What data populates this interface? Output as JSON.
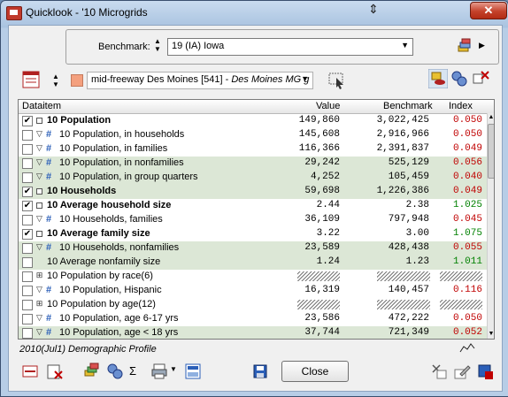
{
  "window": {
    "title": "Quicklook - '10 Microgrids",
    "close_glyph": "✕"
  },
  "benchmark": {
    "label": "Benchmark:",
    "value": "19 (IA) Iowa"
  },
  "geography": {
    "value": "mid-freeway Des Moines [541] - ",
    "value_italic": "Des Moines MG g",
    "swatch_color": "#f4a07e"
  },
  "grid": {
    "headers": {
      "item": "Dataitem",
      "value": "Value",
      "benchmark": "Benchmark",
      "index": "Index"
    },
    "rows": [
      {
        "checked": true,
        "kind": "header",
        "label": "10 Population",
        "bold": true,
        "value": "149,860",
        "benchmark": "3,022,425",
        "index": "0.050",
        "index_color": "#c00000",
        "shade": false
      },
      {
        "checked": false,
        "kind": "item",
        "label": "10 Population, in households",
        "bold": false,
        "value": "145,608",
        "benchmark": "2,916,966",
        "index": "0.050",
        "index_color": "#c00000",
        "shade": false
      },
      {
        "checked": false,
        "kind": "item",
        "label": "10 Population, in families",
        "bold": false,
        "value": "116,366",
        "benchmark": "2,391,837",
        "index": "0.049",
        "index_color": "#c00000",
        "shade": false
      },
      {
        "checked": false,
        "kind": "item",
        "label": "10 Population, in nonfamilies",
        "bold": false,
        "value": "29,242",
        "benchmark": "525,129",
        "index": "0.056",
        "index_color": "#c00000",
        "shade": true
      },
      {
        "checked": false,
        "kind": "item",
        "label": "10 Population, in group quarters",
        "bold": false,
        "value": "4,252",
        "benchmark": "105,459",
        "index": "0.040",
        "index_color": "#c00000",
        "shade": true
      },
      {
        "checked": true,
        "kind": "header",
        "label": "10 Households",
        "bold": true,
        "value": "59,698",
        "benchmark": "1,226,386",
        "index": "0.049",
        "index_color": "#c00000",
        "shade": true
      },
      {
        "checked": true,
        "kind": "header",
        "label": "10 Average household size",
        "bold": true,
        "value": "2.44",
        "benchmark": "2.38",
        "index": "1.025",
        "index_color": "#008000",
        "shade": false
      },
      {
        "checked": false,
        "kind": "item",
        "label": "10 Households, families",
        "bold": false,
        "value": "36,109",
        "benchmark": "797,948",
        "index": "0.045",
        "index_color": "#c00000",
        "shade": false
      },
      {
        "checked": true,
        "kind": "header",
        "label": "10 Average family size",
        "bold": true,
        "value": "3.22",
        "benchmark": "3.00",
        "index": "1.075",
        "index_color": "#008000",
        "shade": false
      },
      {
        "checked": false,
        "kind": "item",
        "label": "10 Households, nonfamilies",
        "bold": false,
        "value": "23,589",
        "benchmark": "428,438",
        "index": "0.055",
        "index_color": "#c00000",
        "shade": true
      },
      {
        "checked": false,
        "kind": "plain",
        "label": "10 Average nonfamily size",
        "bold": false,
        "value": "1.24",
        "benchmark": "1.23",
        "index": "1.011",
        "index_color": "#008000",
        "shade": true
      },
      {
        "checked": false,
        "kind": "group",
        "label": "10 Population by race(6)",
        "bold": false,
        "value": "",
        "benchmark": "",
        "index": "",
        "index_color": "#000000",
        "shade": false,
        "hatched": true
      },
      {
        "checked": false,
        "kind": "item",
        "label": "10 Population, Hispanic",
        "bold": false,
        "value": "16,319",
        "benchmark": "140,457",
        "index": "0.116",
        "index_color": "#c00000",
        "shade": false
      },
      {
        "checked": false,
        "kind": "group",
        "label": "10 Population by age(12)",
        "bold": false,
        "value": "",
        "benchmark": "",
        "index": "",
        "index_color": "#000000",
        "shade": false,
        "hatched": true
      },
      {
        "checked": false,
        "kind": "item",
        "label": "10 Population, age 6-17 yrs",
        "bold": false,
        "value": "23,586",
        "benchmark": "472,222",
        "index": "0.050",
        "index_color": "#c00000",
        "shade": false
      },
      {
        "checked": false,
        "kind": "item",
        "label": "10 Population, age < 18 yrs",
        "bold": false,
        "value": "37,744",
        "benchmark": "721,349",
        "index": "0.052",
        "index_color": "#c00000",
        "shade": true
      }
    ]
  },
  "status": {
    "text": "2010(Jul1) Demographic Profile"
  },
  "buttons": {
    "close": "Close",
    "sigma": "Σ"
  }
}
